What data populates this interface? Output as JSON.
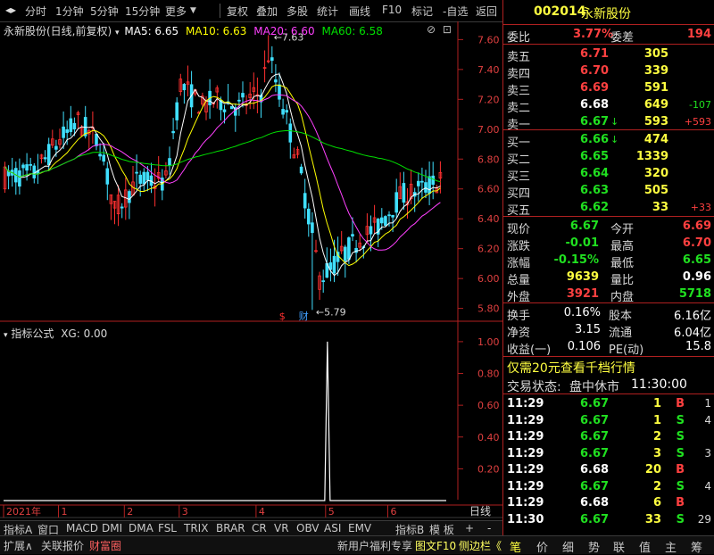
{
  "toolbar": {
    "items": [
      "分时",
      "1分钟",
      "5分钟",
      "15分钟",
      "更多",
      "复权",
      "叠加",
      "多股",
      "统计",
      "画线",
      "F10",
      "标记",
      "-自选",
      "返回"
    ]
  },
  "chart_header": {
    "title": "永新股份(日线,前复权)",
    "ma5": "MA5: 6.65",
    "ma10": "MA10: 6.63",
    "ma20": "MA20: 6.60",
    "ma60": "MA60: 6.58",
    "colors": {
      "ma5": "#ffffff",
      "ma10": "#ffff00",
      "ma20": "#ff40ff",
      "ma60": "#00e000"
    }
  },
  "indicator_header": {
    "title": "指标公式",
    "value": "XG: 0.00"
  },
  "chart_data": [
    {
      "type": "candlestick",
      "title": "永新股份(日线,前复权)",
      "y_ticks": [
        "7.60",
        "7.40",
        "7.20",
        "7.00",
        "6.80",
        "6.60",
        "6.40",
        "6.20",
        "6.00",
        "5.80"
      ],
      "ylim": [
        5.75,
        7.65
      ],
      "annotations": [
        {
          "text": "7.63",
          "value": 7.63,
          "month": "4"
        },
        {
          "text": "5.79",
          "value": 5.79,
          "month": "5"
        }
      ],
      "markers": [
        {
          "text": "$",
          "color": "#ff3030"
        },
        {
          "text": "财",
          "color": "#40a0ff"
        }
      ],
      "x_ticks": [
        "2021年",
        "1",
        "2",
        "3",
        "4",
        "5",
        "6"
      ],
      "series_names": [
        "MA5",
        "MA10",
        "MA20",
        "MA60"
      ]
    },
    {
      "type": "line",
      "title": "指标公式",
      "y_ticks": [
        "1.00",
        "0.80",
        "0.60",
        "0.40",
        "0.20"
      ],
      "ylim": [
        0,
        1.05
      ],
      "series": [
        {
          "name": "XG",
          "spike_month": "5",
          "peak": 1.0
        }
      ]
    }
  ],
  "x_axis": {
    "labels": [
      "2021年",
      "1",
      "2",
      "3",
      "4",
      "5",
      "6"
    ],
    "right_label": "日线"
  },
  "tabs_row1": {
    "items": [
      "指标A",
      "窗口",
      "MACD",
      "DMI",
      "DMA",
      "FSL",
      "TRIX",
      "BRAR",
      "CR",
      "VR",
      "OBV",
      "ASI",
      "EMV",
      "指标B",
      "模 板",
      "+",
      "-"
    ]
  },
  "tabs_row2": {
    "items": [
      "扩展∧",
      "关联报价",
      "财富圈",
      "新用户福利专享",
      "图文F10",
      "侧边栏《"
    ]
  },
  "stock": {
    "code": "002014",
    "name": "永新股份"
  },
  "order_book": {
    "weibi_label": "委比",
    "weibi": "3.77%",
    "weicha_label": "委差",
    "weicha": "194",
    "sells": [
      {
        "label": "卖五",
        "price": "6.71",
        "vol": "305",
        "chg": ""
      },
      {
        "label": "卖四",
        "price": "6.70",
        "vol": "339",
        "chg": ""
      },
      {
        "label": "卖三",
        "price": "6.69",
        "vol": "591",
        "chg": ""
      },
      {
        "label": "卖二",
        "price": "6.68",
        "vol": "649",
        "chg": "-107"
      },
      {
        "label": "卖一",
        "price": "6.67",
        "vol": "593",
        "chg": "+593"
      }
    ],
    "buys": [
      {
        "label": "买一",
        "price": "6.66",
        "vol": "474",
        "chg": ""
      },
      {
        "label": "买二",
        "price": "6.65",
        "vol": "1339",
        "chg": ""
      },
      {
        "label": "买三",
        "price": "6.64",
        "vol": "320",
        "chg": ""
      },
      {
        "label": "买四",
        "price": "6.63",
        "vol": "505",
        "chg": ""
      },
      {
        "label": "买五",
        "price": "6.62",
        "vol": "33",
        "chg": "+33"
      }
    ]
  },
  "quote": {
    "rows": [
      {
        "l1": "现价",
        "v1": "6.67",
        "l2": "今开",
        "v2": "6.69"
      },
      {
        "l1": "涨跌",
        "v1": "-0.01",
        "l2": "最高",
        "v2": "6.70"
      },
      {
        "l1": "涨幅",
        "v1": "-0.15%",
        "l2": "最低",
        "v2": "6.65"
      },
      {
        "l1": "总量",
        "v1": "9639",
        "l2": "量比",
        "v2": "0.96"
      },
      {
        "l1": "外盘",
        "v1": "3921",
        "l2": "内盘",
        "v2": "5718"
      }
    ]
  },
  "fundamentals": {
    "rows": [
      {
        "l1": "换手",
        "v1": "0.16%",
        "l2": "股本",
        "v2": "6.16亿"
      },
      {
        "l1": "净资",
        "v1": "3.15",
        "l2": "流通",
        "v2": "6.04亿"
      },
      {
        "l1": "收益(一)",
        "v1": "0.106",
        "l2": "PE(动)",
        "v2": "15.8"
      }
    ]
  },
  "promo": "仅需20元查看千档行情",
  "trade_status": {
    "label": "交易状态:",
    "status": "盘中休市",
    "time": "11:30:00"
  },
  "ticks": [
    {
      "time": "11:29",
      "price": "6.67",
      "vol": "1",
      "side": "B"
    },
    {
      "time": "11:29",
      "price": "6.67",
      "vol": "1",
      "side": "S"
    },
    {
      "time": "11:29",
      "price": "6.67",
      "vol": "2",
      "side": "S"
    },
    {
      "time": "11:29",
      "price": "6.67",
      "vol": "3",
      "side": "S"
    },
    {
      "time": "11:29",
      "price": "6.68",
      "vol": "20",
      "side": "B"
    },
    {
      "time": "11:29",
      "price": "6.67",
      "vol": "2",
      "side": "S"
    },
    {
      "time": "11:29",
      "price": "6.68",
      "vol": "6",
      "side": "B"
    },
    {
      "time": "11:30",
      "price": "6.67",
      "vol": "33",
      "side": "S"
    }
  ],
  "tick_extra": {
    "num_a": "1",
    "num_b": "4",
    "num_c": "3",
    "num_d": "4",
    "num_e": "29"
  },
  "right_tabs": [
    "笔",
    "价",
    "细",
    "势",
    "联",
    "值",
    "主",
    "筹"
  ]
}
